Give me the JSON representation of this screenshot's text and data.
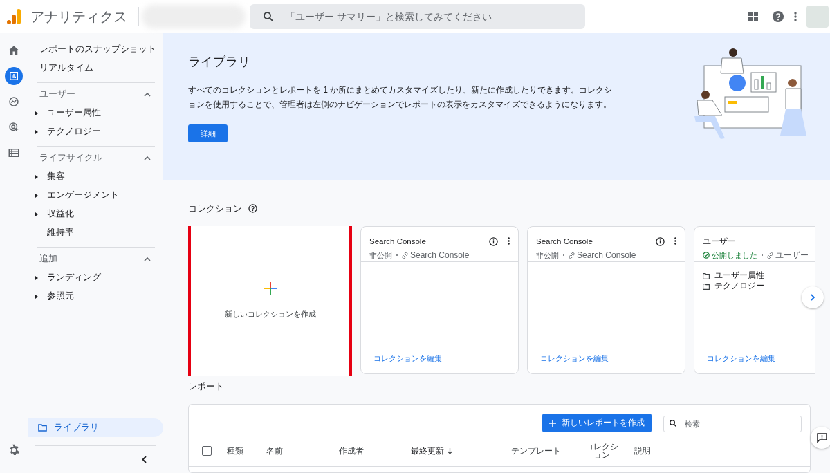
{
  "header": {
    "app_name": "アナリティクス",
    "search": {
      "placeholder": "「ユーザー サマリー」と検索してみてください"
    }
  },
  "rail": [
    {
      "selected": false
    },
    {
      "selected": true
    },
    {
      "selected": false
    },
    {
      "selected": false
    },
    {
      "selected": false
    }
  ],
  "nav": {
    "top_items": [
      "レポートのスナップショット",
      "リアルタイム"
    ],
    "sections": [
      {
        "title": "ユーザー",
        "expanded": true,
        "items": [
          {
            "label": "ユーザー属性",
            "has_children": true
          },
          {
            "label": "テクノロジー",
            "has_children": true
          }
        ]
      },
      {
        "title": "ライフサイクル",
        "expanded": true,
        "items": [
          {
            "label": "集客",
            "has_children": true
          },
          {
            "label": "エンゲージメント",
            "has_children": true
          },
          {
            "label": "収益化",
            "has_children": true
          },
          {
            "label": "維持率",
            "has_children": false
          }
        ]
      },
      {
        "title": "追加",
        "expanded": true,
        "items": [
          {
            "label": "ランディング",
            "has_children": true
          },
          {
            "label": "参照元",
            "has_children": true
          }
        ]
      }
    ],
    "library": {
      "label": "ライブラリ",
      "selected": true
    }
  },
  "banner": {
    "title": "ライブラリ",
    "description": "すべてのコレクションとレポートを 1 か所にまとめてカスタマイズしたり、新たに作成したりできます。コレクションを使用することで、管理者は左側のナビゲーションでレポートの表示をカスタマイズできるようになります。",
    "button": "詳細"
  },
  "collections": {
    "title": "コレクション",
    "cards": [
      {
        "kind": "new",
        "label": "新しいコレクションを作成",
        "highlighted": true
      },
      {
        "kind": "collection",
        "title": "Search Console",
        "published": false,
        "status": "非公開",
        "template": "Search Console",
        "edit": "コレクションを編集"
      },
      {
        "kind": "collection",
        "title": "Search Console",
        "published": false,
        "status": "非公開",
        "template": "Search Console",
        "edit": "コレクションを編集"
      },
      {
        "kind": "collection",
        "title": "ユーザー",
        "published": true,
        "status": "公開しました",
        "template": "ユーザー",
        "items": [
          "ユーザー属性",
          "テクノロジー"
        ],
        "edit": "コレクションを編集"
      }
    ]
  },
  "reports": {
    "title": "レポート",
    "new_button": "新しいレポートを作成",
    "search": {
      "placeholder": "検索"
    },
    "select_all_checked": false,
    "columns": [
      {
        "label": "種類",
        "sorted": false
      },
      {
        "label": "名前",
        "sorted": false
      },
      {
        "label": "作成者",
        "sorted": false
      },
      {
        "label": "最終更新",
        "sorted": true
      },
      {
        "label": "テンプレート",
        "sorted": false
      },
      {
        "label": "コレクション",
        "sorted": false
      },
      {
        "label": "説明",
        "sorted": false
      }
    ]
  }
}
